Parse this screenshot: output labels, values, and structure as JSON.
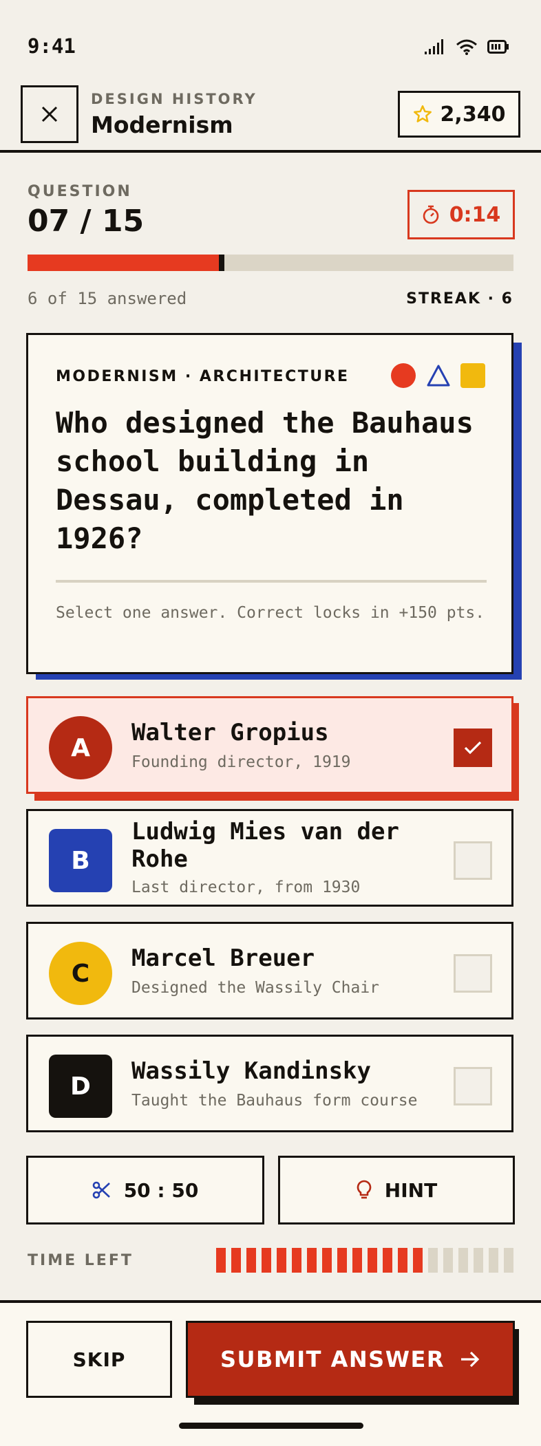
{
  "status_bar": {
    "time": "9:41"
  },
  "header": {
    "eyebrow": "DESIGN HISTORY",
    "title": "Modernism",
    "score": "2,340"
  },
  "question_meta": {
    "label": "QUESTION",
    "counter": "07 / 15",
    "timer": "0:14",
    "answered_text": "6 of 15 answered",
    "streak": "STREAK · 6",
    "progress": 0.4
  },
  "question_card": {
    "category": "MODERNISM · ARCHITECTURE",
    "question": "Who designed the Bauhaus school building in Dessau, completed in 1926?",
    "help": "Select one answer. Correct locks in +150 pts."
  },
  "options": [
    {
      "letter": "A",
      "title": "Walter Gropius",
      "subtitle": "Founding director, 1919",
      "selected": true,
      "color": "#b52a14"
    },
    {
      "letter": "B",
      "title": "Ludwig Mies van der Rohe",
      "subtitle": "Last director, from 1930",
      "selected": false,
      "color": "#2541b2"
    },
    {
      "letter": "C",
      "title": "Marcel Breuer",
      "subtitle": "Designed the Wassily Chair",
      "selected": false,
      "color": "#f1b90e"
    },
    {
      "letter": "D",
      "title": "Wassily Kandinsky",
      "subtitle": "Taught the Bauhaus form course",
      "selected": false,
      "color": "#15120e"
    }
  ],
  "lifelines": {
    "fifty_fifty": "50 : 50",
    "hint": "HINT"
  },
  "time_left": {
    "label": "TIME LEFT",
    "segments_total": 20,
    "segments_filled": 14
  },
  "actions": {
    "skip": "SKIP",
    "submit": "SUBMIT ANSWER"
  },
  "colors": {
    "accent_red": "#e63a20",
    "deep_red": "#b52a14",
    "blue": "#2541b2",
    "yellow": "#f1b90e",
    "ink": "#15120e"
  },
  "icons": [
    "close-icon",
    "star-icon",
    "stopwatch-icon",
    "scissors-icon",
    "lightbulb-icon",
    "arrow-right-icon",
    "check-icon",
    "signal-icon",
    "wifi-icon",
    "battery-icon"
  ]
}
